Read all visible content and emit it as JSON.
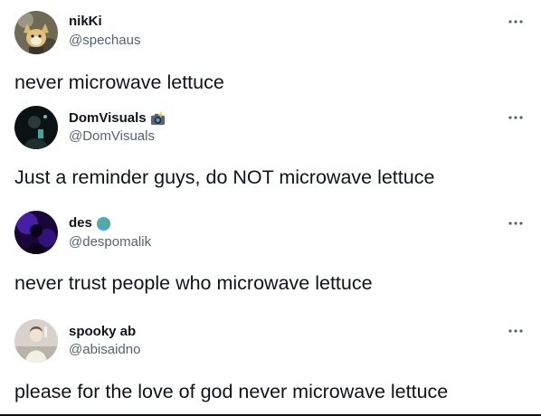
{
  "tweets": [
    {
      "display_name": "nikKi",
      "handle": "@spechaus",
      "text": "never microwave lettuce",
      "avatar_icon": "cat-avatar-icon",
      "badge_icon": ""
    },
    {
      "display_name": "DomVisuals",
      "handle": "@DomVisuals",
      "text": "Just a reminder guys, do NOT microwave lettuce",
      "avatar_icon": "dark-portrait-avatar-icon",
      "badge_icon": "camera-flash-emoji-icon"
    },
    {
      "display_name": "des",
      "handle": "@despomalik",
      "text": "never trust people who microwave lettuce",
      "avatar_icon": "purple-portrait-avatar-icon",
      "badge_icon": "globe-emoji-icon"
    },
    {
      "display_name": "spooky ab",
      "handle": "@abisaidno",
      "text": "please for the love of god never microwave lettuce",
      "avatar_icon": "light-portrait-avatar-icon",
      "badge_icon": ""
    }
  ],
  "colors": {
    "text_primary": "#0f1419",
    "text_secondary": "#536471"
  }
}
